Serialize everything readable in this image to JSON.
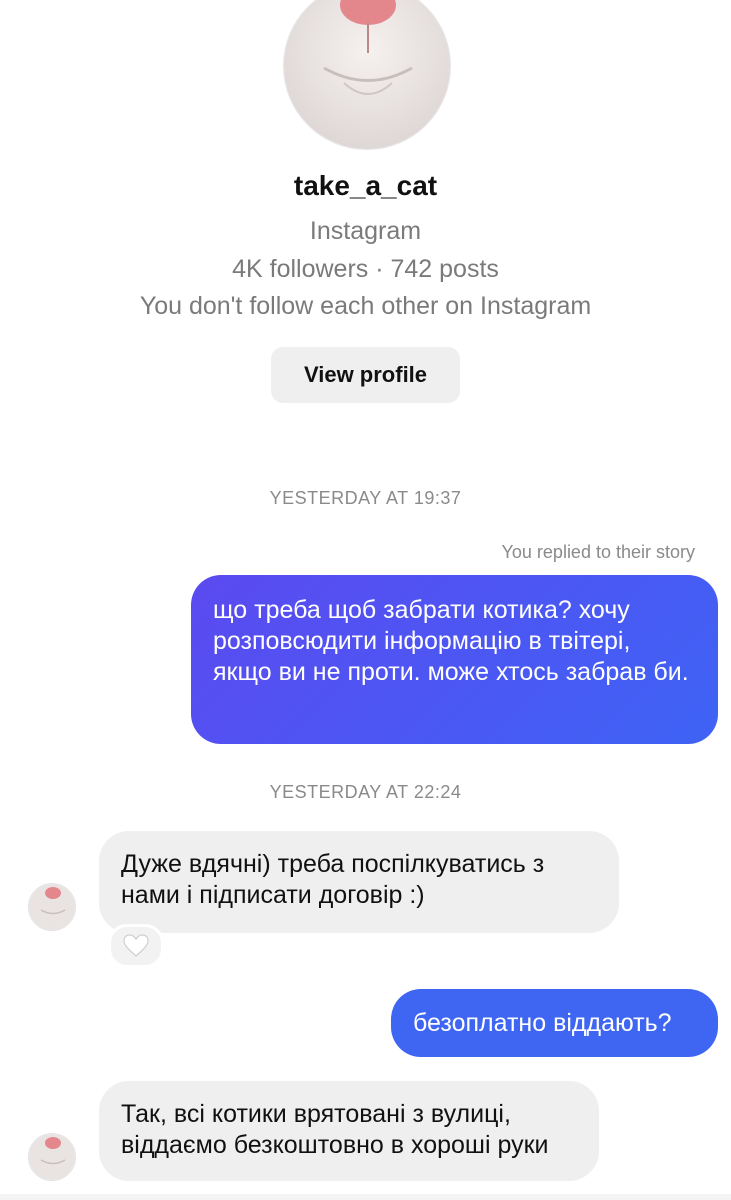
{
  "profile": {
    "username": "take_a_cat",
    "platform": "Instagram",
    "stats": "4K followers · 742 posts",
    "follow_note": "You don't follow each other on Instagram",
    "view_profile_label": "View profile",
    "avatar_icon": "cat-nose-avatar"
  },
  "conversation": {
    "timestamps": [
      "YESTERDAY AT 19:37",
      "YESTERDAY AT 22:24"
    ],
    "story_note": "You replied to their story",
    "messages": [
      {
        "from": "me",
        "text": "що треба щоб забрати котика? хочу розповсюдити інформацію в твітері, якщо ви не проти. може хтось забрав би."
      },
      {
        "from": "them",
        "text": "Дуже вдячні) треба поспілкуватись з нами і підписати договір :)",
        "reaction": "white-heart"
      },
      {
        "from": "me",
        "text": "безоплатно віддають?"
      },
      {
        "from": "them",
        "text": "Так, всі котики врятовані з вулиці, віддаємо безкоштовно в хороші руки"
      }
    ]
  },
  "colors": {
    "outgoing_bubble": "#4a5cf2",
    "incoming_bubble": "#efefef",
    "muted_text": "#7a7a7a"
  }
}
